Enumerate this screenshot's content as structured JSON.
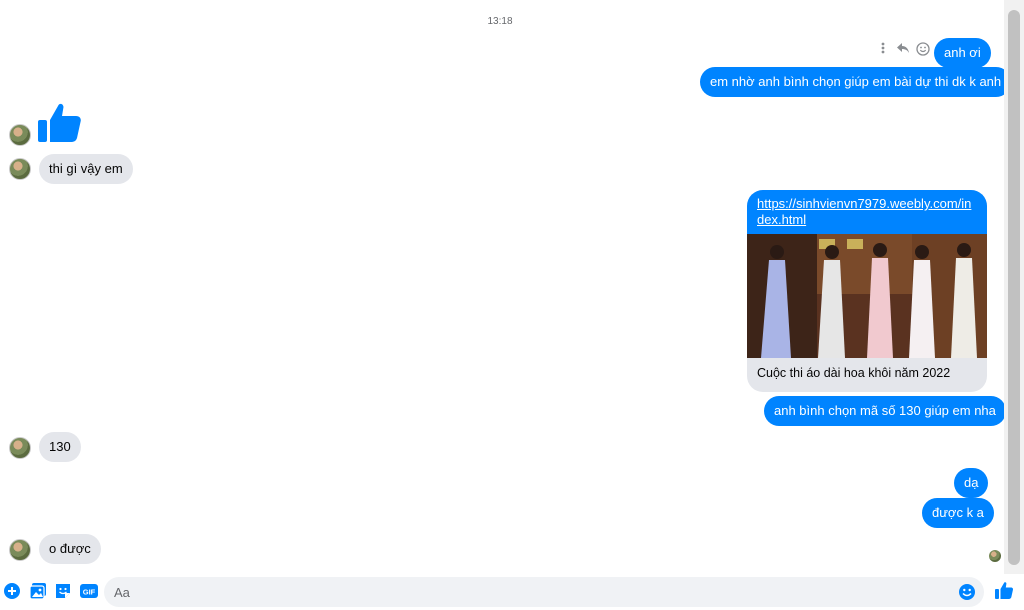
{
  "thread": {
    "timestamp": "13:18",
    "messages": [
      {
        "dir": "out",
        "text": "anh ơi"
      },
      {
        "dir": "out",
        "text": "em nhờ anh bình chọn giúp em bài dự thi dk k anh"
      },
      {
        "dir": "in",
        "type": "like-sticker"
      },
      {
        "dir": "in",
        "text": "thi gì vậy em"
      },
      {
        "dir": "out",
        "type": "link"
      },
      {
        "dir": "out",
        "text": "anh bình chọn mã số 130 giúp em nha"
      },
      {
        "dir": "in",
        "text": "130"
      },
      {
        "dir": "out",
        "text": "dạ"
      },
      {
        "dir": "out",
        "text": "được k a"
      },
      {
        "dir": "in",
        "text": "o được"
      }
    ],
    "link": {
      "url": "https://sinhvienvn7979.weebly.com/index.html",
      "title": "Cuộc thi áo dài hoa khôi năm 2022"
    }
  },
  "composer": {
    "placeholder": "Aa"
  },
  "icons": {
    "add": "plus-circle-icon",
    "photo": "image-icon",
    "sticker": "sticker-icon",
    "gif": "gif-icon",
    "emoji": "emoji-icon",
    "send_like": "thumbs-up-icon",
    "more": "more-vertical-icon",
    "reply": "reply-icon",
    "react": "smiley-icon"
  },
  "colors": {
    "accent": "#0084ff",
    "incoming_bubble": "#e4e6eb",
    "outgoing_bubble": "#0084ff"
  }
}
